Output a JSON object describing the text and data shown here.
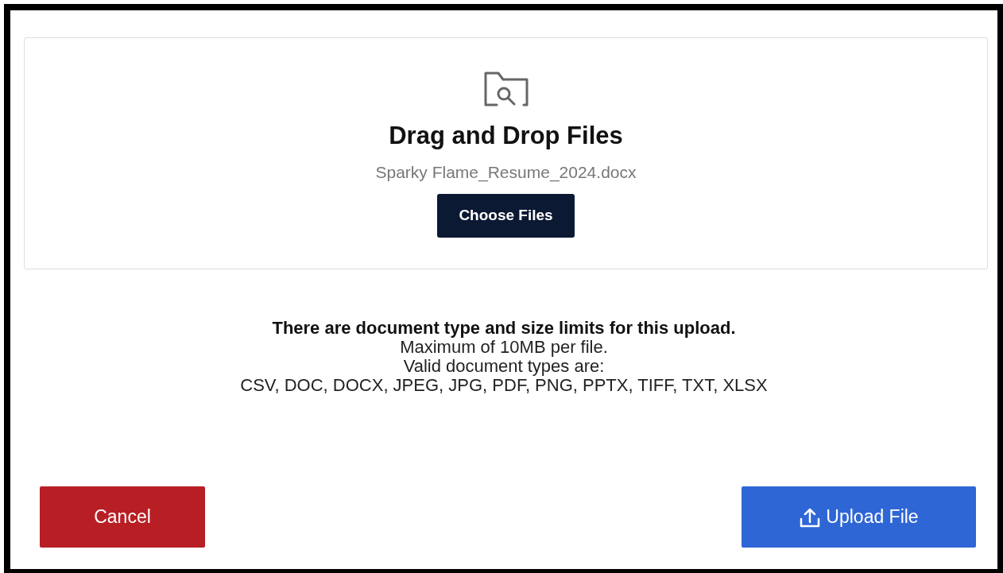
{
  "dropzone": {
    "title": "Drag and Drop Files",
    "file_name": "Sparky Flame_Resume_2024.docx",
    "choose_button": "Choose Files"
  },
  "limits": {
    "heading": "There are document type and size limits for this upload.",
    "lines": [
      "Maximum of 10MB per file.",
      "Valid document types are:",
      "CSV, DOC, DOCX, JPEG, JPG, PDF, PNG, PPTX, TIFF, TXT, XLSX"
    ]
  },
  "buttons": [
    {
      "kind": "cancel",
      "label": "Cancel"
    },
    {
      "kind": "upload",
      "label": "Upload File"
    }
  ]
}
